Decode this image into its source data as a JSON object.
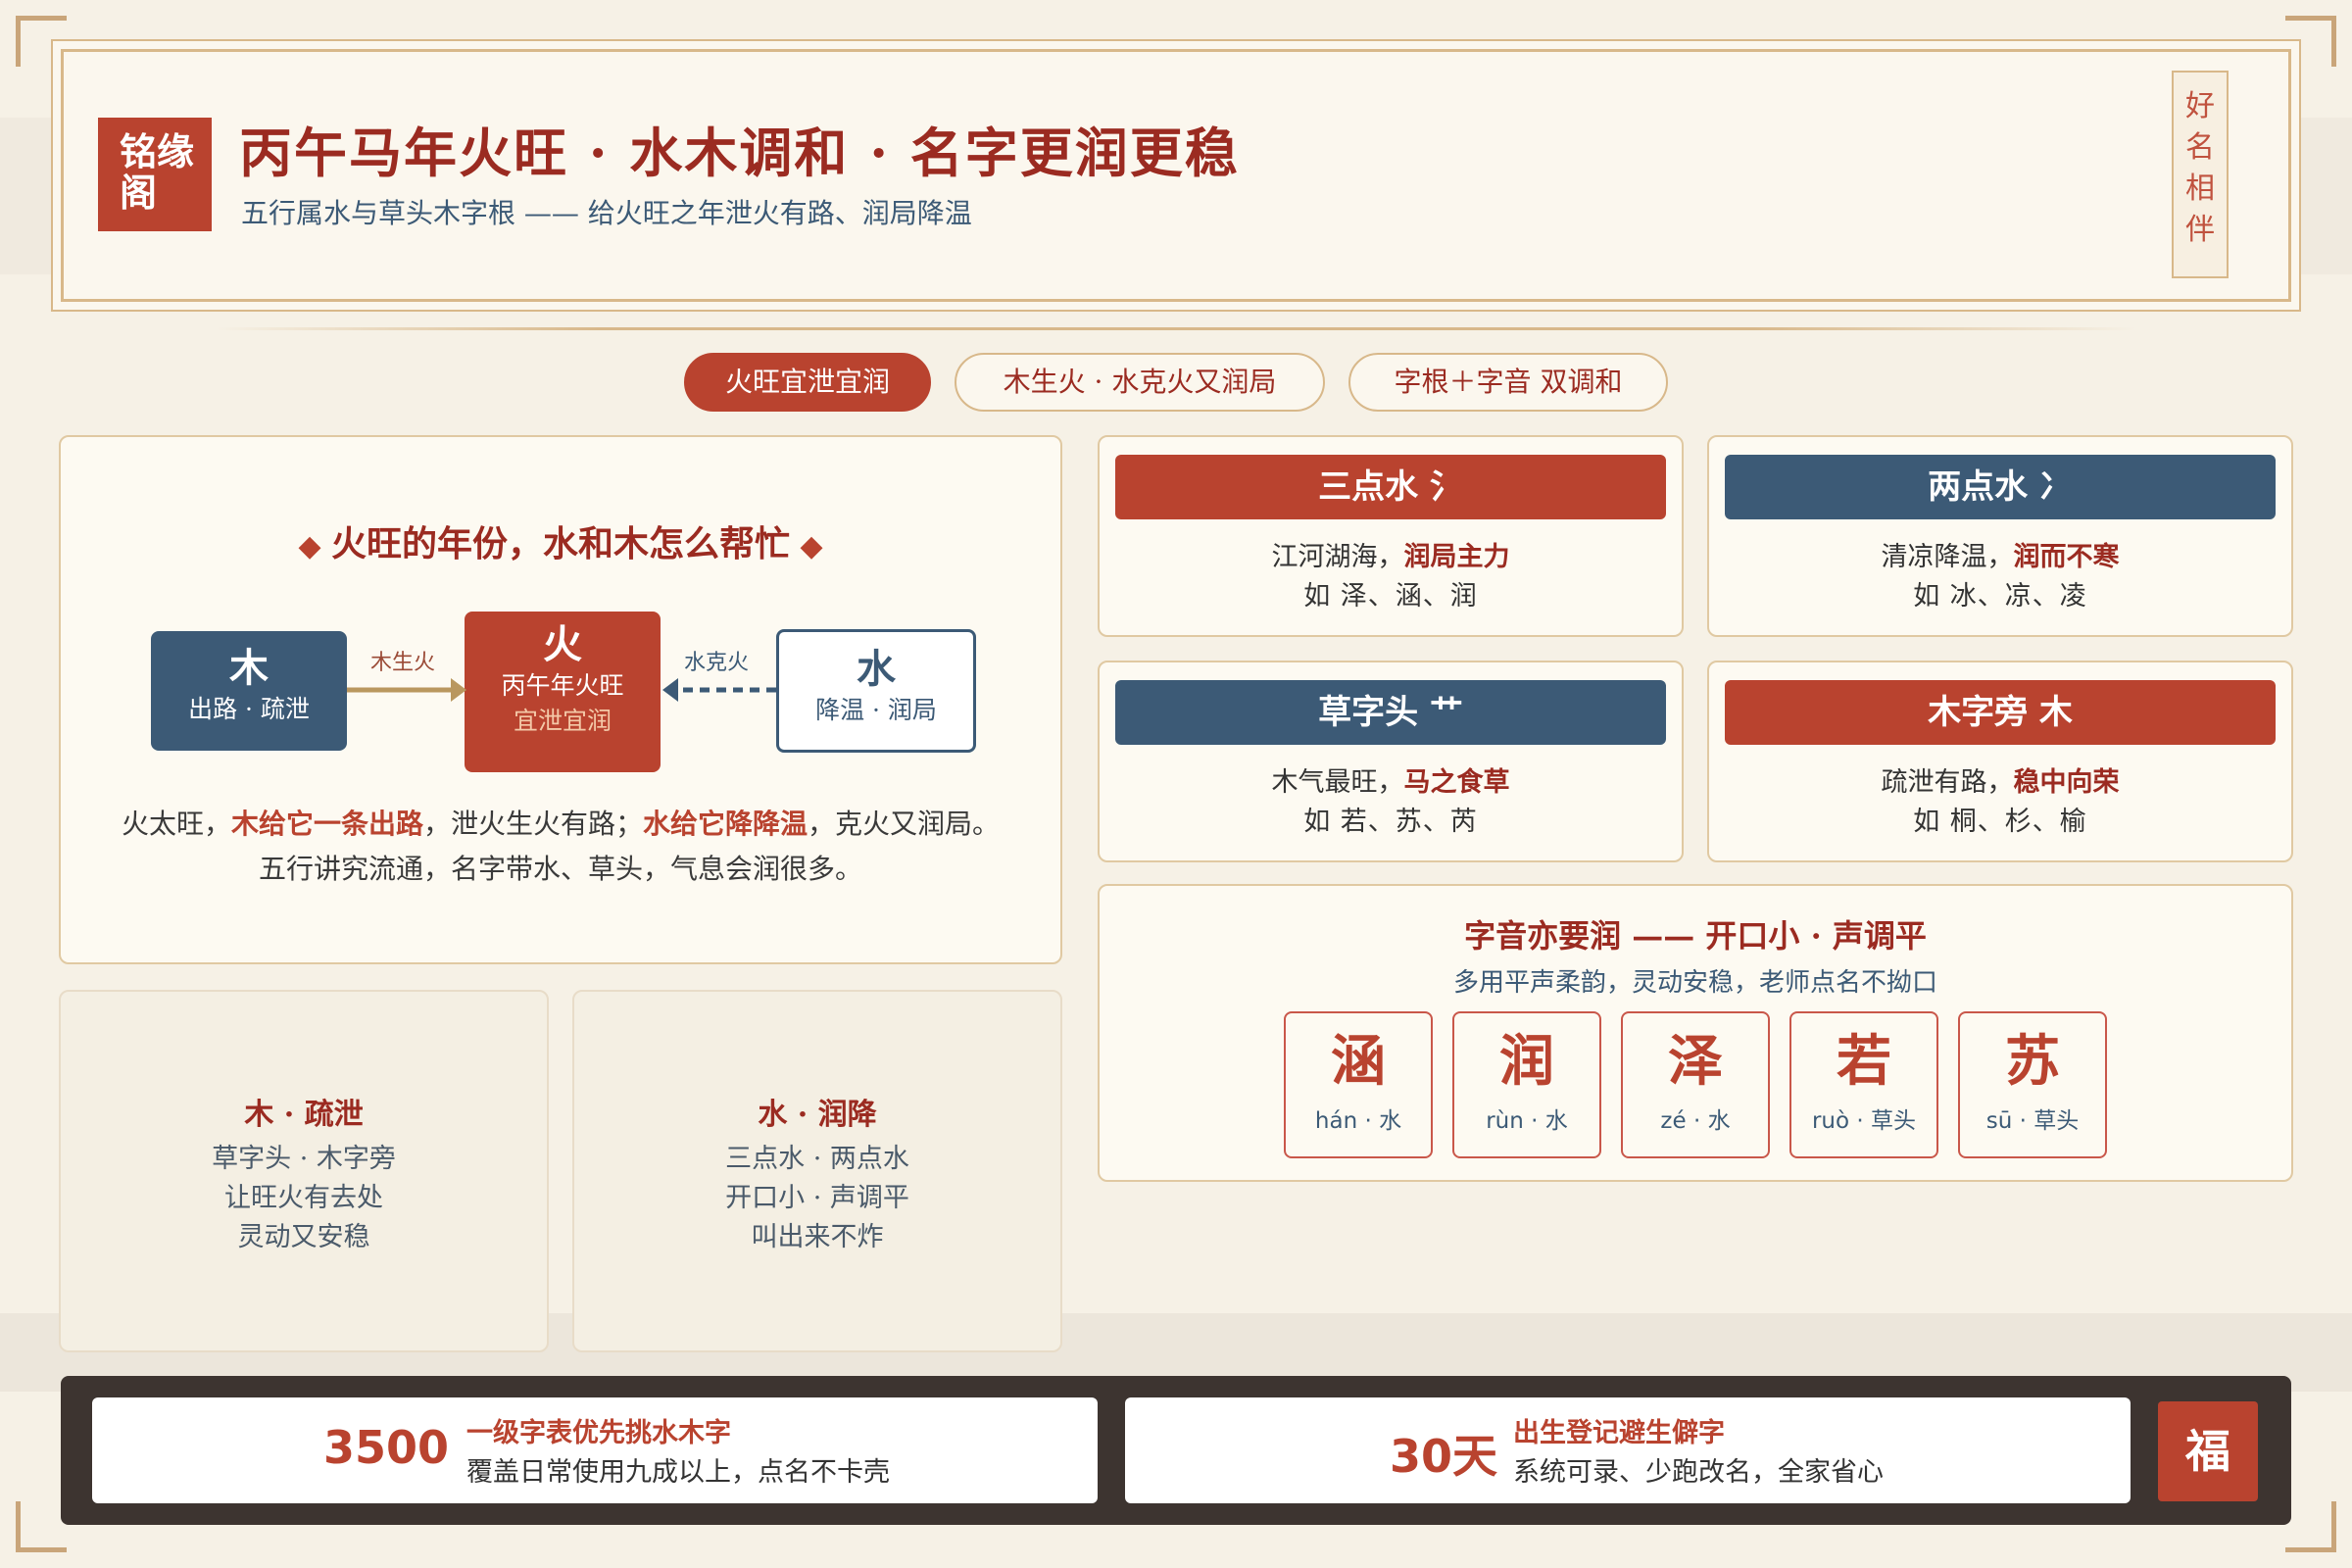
{
  "header": {
    "logo": "铭缘阁",
    "title": "丙午马年火旺 · 水木调和 · 名字更润更稳",
    "subtitle": "五行属水与草头木字根 —— 给火旺之年泄火有路、润局降温",
    "seal": "好名相伴"
  },
  "tabs": [
    {
      "label": "火旺宜泄宜润"
    },
    {
      "label": "木生火 · 水克火又润局"
    },
    {
      "label": "字根＋字音 双调和"
    }
  ],
  "left_panel": {
    "title": "火旺的年份，水和木怎么帮忙",
    "nodes": {
      "wood": {
        "big": "木",
        "small": "出路 · 疏泄"
      },
      "fire": {
        "big": "火",
        "small": "丙午年火旺",
        "note": "宜泄宜润"
      },
      "water": {
        "big": "水",
        "small": "降温 · 润局"
      }
    },
    "arrows": {
      "wood_to_fire": "木生火",
      "water_to_fire": "水克火"
    },
    "para": {
      "p1_a": "火太旺，",
      "p1_b": "木给它一条出路",
      "p1_c": "，泄火生火有路；",
      "p1_d": "水给它降降温",
      "p1_e": "，克火又润局。",
      "p2": "五行讲究流通，名字带水、草头，气息会润很多。"
    }
  },
  "mini_cards": [
    {
      "title": "木 · 疏泄",
      "lines": [
        "草字头 · 木字旁",
        "让旺火有去处",
        "灵动又安稳"
      ]
    },
    {
      "title": "水 · 润降",
      "lines": [
        "三点水 · 两点水",
        "开口小 · 声调平",
        "叫出来不炸"
      ]
    }
  ],
  "radical_cards": [
    {
      "head": "三点水 氵",
      "line1_a": "江河湖海，",
      "line1_b": "润局主力",
      "line2": "如 泽、涵、润",
      "color": "#b9432f"
    },
    {
      "head": "两点水 冫",
      "line1_a": "清凉降温，",
      "line1_b": "润而不寒",
      "line2": "如 冰、凉、凌",
      "color": "#3c5a76"
    },
    {
      "head": "草字头 艹",
      "line1_a": "木气最旺，",
      "line1_b": "马之食草",
      "line2": "如 若、苏、芮",
      "color": "#3c5a76"
    },
    {
      "head": "木字旁 木",
      "line1_a": "疏泄有路，",
      "line1_b": "稳中向荣",
      "line2": "如 桐、杉、榆",
      "color": "#b9432f"
    }
  ],
  "sound_panel": {
    "title": "字音亦要润 —— 开口小 · 声调平",
    "subtitle": "多用平声柔韵，灵动安稳，老师点名不拗口",
    "chars": [
      {
        "ch": "涵",
        "py": "hán · 水"
      },
      {
        "ch": "润",
        "py": "rùn · 水"
      },
      {
        "ch": "泽",
        "py": "zé · 水"
      },
      {
        "ch": "若",
        "py": "ruò · 草头"
      },
      {
        "ch": "苏",
        "py": "sū · 草头"
      }
    ]
  },
  "footer": {
    "stats": [
      {
        "num": "3500",
        "t1": "一级字表优先挑水木字",
        "t2": "覆盖日常使用九成以上，点名不卡壳"
      },
      {
        "num": "30天",
        "t1": "出生登记避生僻字",
        "t2": "系统可录、少跑改名，全家省心"
      }
    ],
    "fu": "福"
  },
  "colors": {
    "red": "#b9432f",
    "blue": "#3c5a76",
    "gold": "#d8b88a",
    "dark": "#3d3430"
  }
}
